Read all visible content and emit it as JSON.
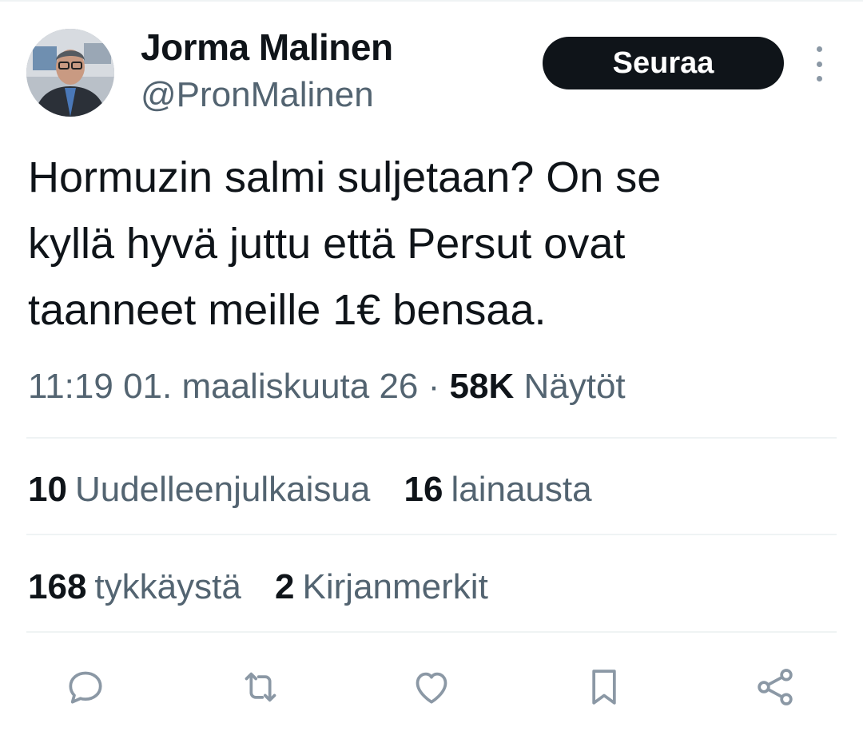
{
  "author": {
    "name": "Jorma Malinen",
    "handle": "@PronMalinen",
    "avatar_icon": "profile-photo"
  },
  "follow_label": "Seuraa",
  "tweet": {
    "text": "Hormuzin salmi suljetaan? On se\nkyllä hyvä juttu että Persut ovat\ntaanneet meille 1€ bensaa.",
    "time": "11:19 01. maaliskuuta 26",
    "separator": "·",
    "views_count": "58K",
    "views_label": "Näytöt"
  },
  "stats": {
    "reposts_count": "10",
    "reposts_label": "Uudelleenjulkaisua",
    "quotes_count": "16",
    "quotes_label": "lainausta",
    "likes_count": "168",
    "likes_label": "tykkäystä",
    "bookmarks_count": "2",
    "bookmarks_label": "Kirjanmerkit"
  },
  "actions": [
    "reply-icon",
    "repost-icon",
    "like-icon",
    "bookmark-icon",
    "share-icon"
  ],
  "colors": {
    "text": "#0f1419",
    "secondary": "#536471",
    "divider": "#eff3f4",
    "icon": "#8b98a5",
    "button_bg": "#0f1419"
  }
}
